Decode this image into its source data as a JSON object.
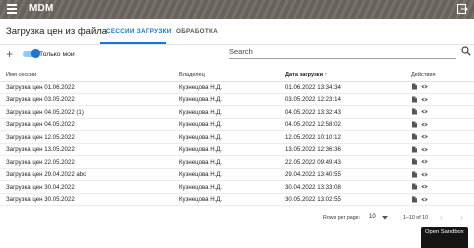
{
  "header": {
    "app_title": "MDM"
  },
  "page": {
    "title": "Загрузка цен из файла"
  },
  "tabs": [
    {
      "label": "СЕССИИ ЗАГРУЗКИ",
      "active": true
    },
    {
      "label": "ОБРАБОТКА",
      "active": false
    }
  ],
  "toolbar": {
    "toggle_label": "Только мои",
    "toggle_on": true,
    "search_placeholder": "Search"
  },
  "table": {
    "columns": [
      "Имя сессии",
      "Владелец",
      "Дата загрузки",
      "Действия"
    ],
    "sort_icon": "↑",
    "rows": [
      [
        "Загрузка цен 01.06.2022",
        "Кузнецова Н.Д.",
        "01.06.2022 13:34:34"
      ],
      [
        "Загрузка цен 03.05.2022",
        "Кузнецова Н.Д.",
        "03.05.2022 12:23:14"
      ],
      [
        "Загрузка цен 04.05.2022 (1)",
        "Кузнецова Н.Д.",
        "04.05.2022 13:32:43"
      ],
      [
        "Загрузка цен 04.05.2022",
        "Кузнецова Н.Д.",
        "04.05.2022 12:58:02"
      ],
      [
        "Загрузка цен 12.05.2022",
        "Кузнецова Н.Д.",
        "12.05.2022 10:10:12"
      ],
      [
        "Загрузка цен 13.05.2022",
        "Кузнецова Н.Д.",
        "13.05.2022 12:36:36"
      ],
      [
        "Загрузка цен 22.05.2022",
        "Кузнецова Н.Д.",
        "22.05.2022 09:49:43"
      ],
      [
        "Загрузка цен 29.04.2022 abc",
        "Кузнецова Н.Д.",
        "29.04.2022 13:40:55"
      ],
      [
        "Загрузка цен 30.04.2022",
        "Кузнецова Н.Д.",
        "30.04.2022 13:33:08"
      ],
      [
        "Загрузка цен 30.05.2022",
        "Кузнецова Н.Д.",
        "30.05.2022 13:02:55"
      ]
    ]
  },
  "pagination": {
    "rows_per_page_label": "Rows per page:",
    "rows_per_page_value": "10",
    "range_text": "1–10 of 10",
    "prev": "‹",
    "next": "›"
  },
  "sandbox": {
    "label": "Open Sandbox"
  },
  "colors": {
    "primary": "#1976d2",
    "header_bg": "#6d6861"
  },
  "icons": [
    "menu-icon",
    "logout-icon",
    "add-icon",
    "search-icon",
    "sort-arrow-icon",
    "file-icon",
    "eye-icon",
    "chevron-left-icon",
    "chevron-right-icon"
  ]
}
